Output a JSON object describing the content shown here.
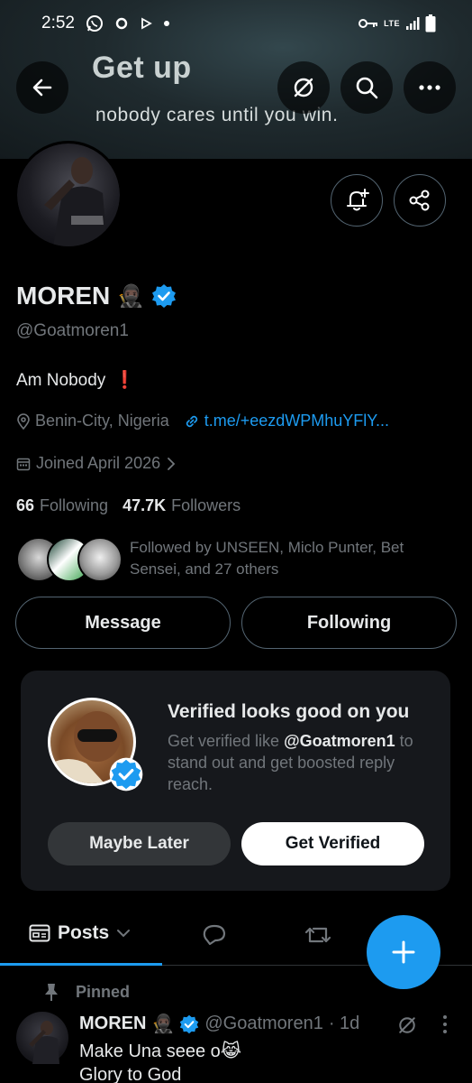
{
  "status_bar": {
    "time": "2:52",
    "network": "LTE"
  },
  "banner": {
    "title": "Get up",
    "subtitle": "nobody cares until you win."
  },
  "profile": {
    "name": "MOREN",
    "name_emoji": "🥷🏿",
    "handle": "@Goatmoren1",
    "bio": "Am Nobody",
    "bio_emoji": "❗",
    "location": "Benin-City, Nigeria",
    "link": "t.me/+eezdWPMhuYFlY...",
    "joined": "Joined April 2026",
    "following_count": "66",
    "following_label": "Following",
    "followers_count": "47.7K",
    "followers_label": "Followers",
    "followed_by": "Followed by UNSEEN, Miclo Punter, Bet Sensei, and 27 others"
  },
  "actions": {
    "message": "Message",
    "following": "Following"
  },
  "verified_card": {
    "title": "Verified looks good on you",
    "desc_prefix": "Get verified like ",
    "desc_handle": "@Goatmoren1",
    "desc_suffix": " to stand out and get boosted reply reach.",
    "maybe_later": "Maybe Later",
    "get_verified": "Get Verified"
  },
  "tabs": {
    "posts": "Posts"
  },
  "pinned_post": {
    "pinned_label": "Pinned",
    "name": "MOREN",
    "name_emoji": "🥷🏿",
    "handle": "@Goatmoren1",
    "time": "· 1d",
    "line1": "Make Una seee o😹",
    "line2": "Glory to God"
  },
  "colors": {
    "accent": "#1d9bf0",
    "background": "#000000",
    "card": "#16181c",
    "muted": "#71767b"
  }
}
